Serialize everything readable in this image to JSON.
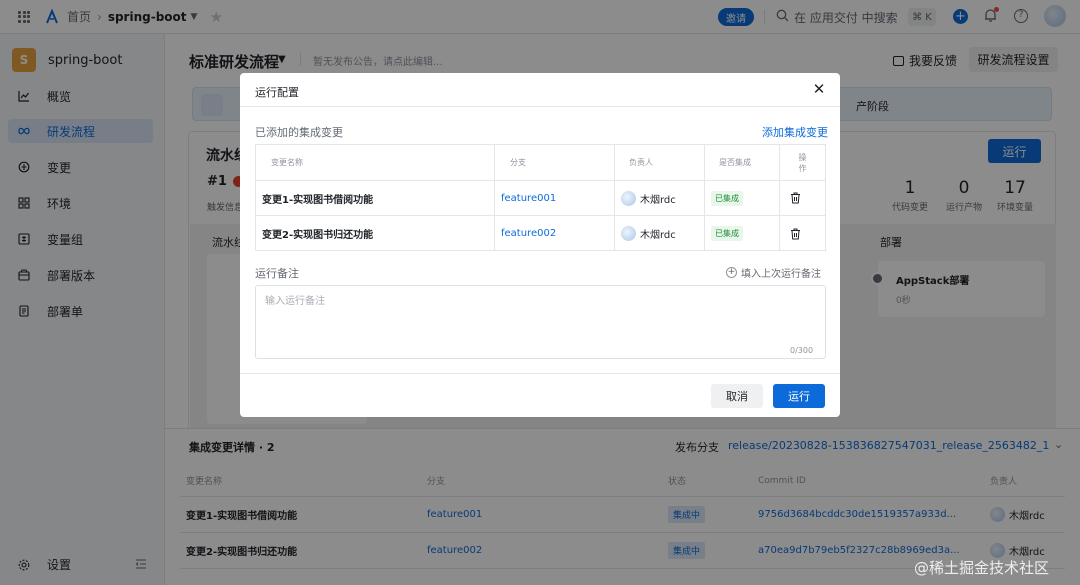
{
  "topbar": {
    "home": "首页",
    "project": "spring-boot",
    "invite": "邀请",
    "search_placeholder": "在 应用交付 中搜索",
    "shortcut": "⌘ K"
  },
  "sidebar": {
    "project_initial": "S",
    "project_name": "spring-boot",
    "items": [
      {
        "label": "概览",
        "icon": "chart-line-icon"
      },
      {
        "label": "研发流程",
        "icon": "infinity-icon"
      },
      {
        "label": "变更",
        "icon": "change-icon"
      },
      {
        "label": "环境",
        "icon": "grid-icon"
      },
      {
        "label": "变量组",
        "icon": "variable-icon"
      },
      {
        "label": "部署版本",
        "icon": "box-icon"
      },
      {
        "label": "部署单",
        "icon": "document-icon"
      }
    ],
    "settings": "设置"
  },
  "main": {
    "title": "标准研发流程",
    "announcement": "暂无发布公告，请点此编辑...",
    "feedback": "我要反馈",
    "settings_button": "研发流程设置",
    "banner_stage": "产阶段",
    "pipeline": {
      "title": "流水线",
      "run_id": "#1",
      "trigger": "触发信息",
      "run_button": "运行",
      "stats": [
        {
          "value": "1",
          "label": "代码变更"
        },
        {
          "value": "0",
          "label": "运行产物"
        },
        {
          "value": "17",
          "label": "环境变量"
        }
      ],
      "col1_title": "流水线",
      "deploy_col_title": "部署",
      "deploy_job": "AppStack部署",
      "deploy_time": "0秒"
    },
    "integration": {
      "title": "集成变更详情 · 2",
      "branch_label": "发布分支",
      "branch_value": "release/20230828-153836827547031_release_2563482_1",
      "headers": [
        "变更名称",
        "分支",
        "状态",
        "Commit ID",
        "负责人"
      ],
      "rows": [
        {
          "name": "变更1-实现图书借阅功能",
          "branch": "feature001",
          "status": "集成中",
          "commit": "9756d3684bcddc30de1519357a933d...",
          "owner": "木烟rdc"
        },
        {
          "name": "变更2-实现图书归还功能",
          "branch": "feature002",
          "status": "集成中",
          "commit": "a70ea9d7b79eb5f2327c28b8969ed3a...",
          "owner": "木烟rdc"
        }
      ]
    }
  },
  "modal": {
    "title": "运行配置",
    "section_label": "已添加的集成变更",
    "add_link": "添加集成变更",
    "headers": {
      "name": "变更名称",
      "branch": "分支",
      "owner": "负责人",
      "integrated": "是否集成",
      "action_l1": "操",
      "action_l2": "作"
    },
    "rows": [
      {
        "name": "变更1-实现图书借阅功能",
        "branch": "feature001",
        "owner": "木烟rdc",
        "integrated": "已集成"
      },
      {
        "name": "变更2-实现图书归还功能",
        "branch": "feature002",
        "owner": "木烟rdc",
        "integrated": "已集成"
      }
    ],
    "note_label": "运行备注",
    "fill_last": "填入上次运行备注",
    "note_placeholder": "输入运行备注",
    "counter": "0/300",
    "cancel": "取消",
    "run": "运行"
  },
  "watermark": "@稀土掘金技术社区"
}
